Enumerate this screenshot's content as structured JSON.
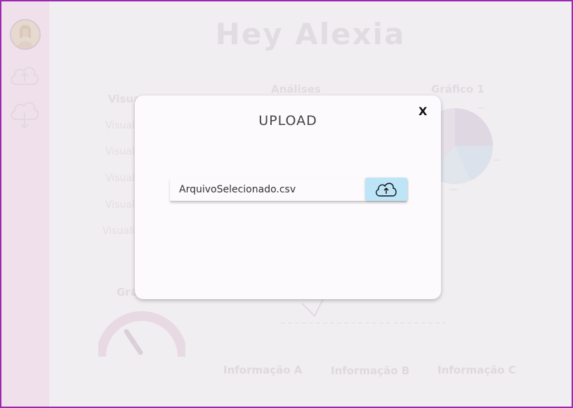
{
  "greeting": "Hey Alexia",
  "sections": {
    "visualizacoes_title": "Visua",
    "analises_title": "Análises",
    "grafico1_title": "Gráfico 1",
    "gauge_title": "Grá"
  },
  "visual_items": [
    "Visual",
    "Visual",
    "Visual",
    "Visual",
    "Visuali"
  ],
  "info_labels": [
    "Informação A",
    "Informação B",
    "Informação C"
  ],
  "modal": {
    "title": "UPLOAD",
    "close_label": "X",
    "file_value": "ArquivoSelecionado.csv",
    "upload_icon": "cloud-upload-icon"
  },
  "sidebar": {
    "icons": [
      "avatar",
      "cloud-upload-icon",
      "cloud-download-icon"
    ]
  },
  "colors": {
    "frame_border": "#9c27b0",
    "sidebar_bg": "#f3e4ef",
    "upload_button_bg": "#bde4f7"
  }
}
